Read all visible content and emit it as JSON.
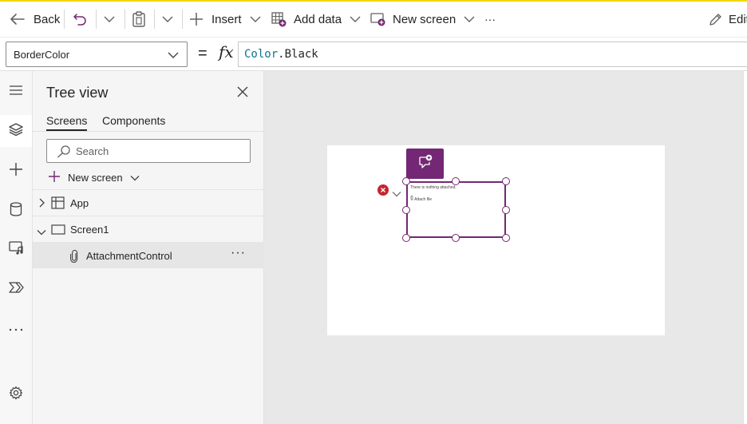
{
  "command_bar": {
    "back_label": "Back",
    "insert_label": "Insert",
    "add_data_label": "Add data",
    "new_screen_label": "New screen",
    "more_label": "···",
    "edit_label": "Edit"
  },
  "formula_bar": {
    "property": "BorderColor",
    "equals": "=",
    "fx": "fx",
    "formula_ident": "Color",
    "formula_dot": ".",
    "formula_member": "Black"
  },
  "left_rail": {
    "items": [
      "hamburger-icon",
      "layers-icon",
      "plus-icon",
      "database-icon",
      "media-icon",
      "power-automate-icon",
      "more-icon"
    ],
    "bottom": "settings-icon",
    "active_index": 1
  },
  "tree_view": {
    "title": "Tree view",
    "tabs": [
      "Screens",
      "Components"
    ],
    "selected_tab": "Screens",
    "search_placeholder": "Search",
    "new_screen_label": "New screen",
    "nodes": [
      {
        "label": "App",
        "icon": "app-icon",
        "expanded": false
      },
      {
        "label": "Screen1",
        "icon": "screen-icon",
        "expanded": true
      },
      {
        "label": "AttachmentControl",
        "icon": "paperclip-icon",
        "selected": true
      }
    ],
    "row_more": "···"
  },
  "canvas": {
    "attachment_message": "There is nothing attached.",
    "attach_link": "Attach file"
  },
  "colors": {
    "accent": "#742774",
    "error": "#c4262e",
    "canvas_bg": "#e8e8e8",
    "command_bar_top_border": "#f2d600",
    "formula_ident": "#0e7490"
  }
}
